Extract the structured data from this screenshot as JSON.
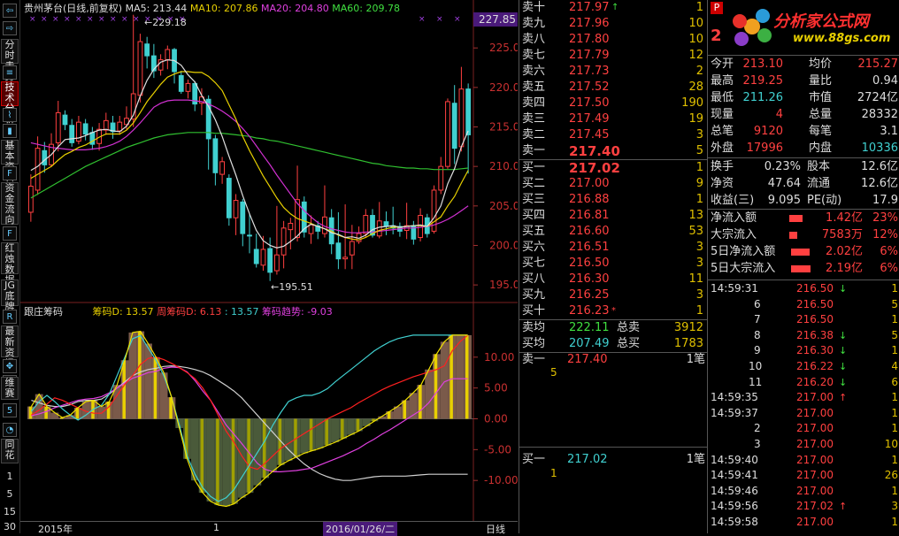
{
  "sidebar": {
    "items": [
      "分时走势",
      "技术分析",
      "基本资料",
      "资金流向",
      "红烛数据",
      "底牌",
      "JG",
      "最新资讯",
      "维赛",
      "同花",
      "资金",
      "点评",
      "诊测"
    ],
    "numbers": [
      "1",
      "5",
      "15",
      "30"
    ]
  },
  "chart": {
    "title": "贵州茅台(日线,前复权)",
    "ma5": "MA5: 213.44",
    "ma10": "MA10: 207.86",
    "ma20": "MA20: 204.80",
    "ma60": "MA60: 209.78",
    "price_tag": "227.85",
    "high_label": "229.18",
    "low_label": "195.51",
    "y_ticks": [
      "225.0",
      "220.0",
      "215.0",
      "210.0",
      "205.0",
      "200.0",
      "195.0"
    ],
    "sub_title": "跟庄筹码",
    "sub_d": "筹码D: 13.57",
    "sub_wd": "周筹码D: 6.13",
    "sub_val": ": 13.57",
    "sub_trend": "筹码趋势: -9.03",
    "sub_ticks": [
      "10.00",
      "5.00",
      "0.00",
      "-5.00",
      "-10.00"
    ],
    "x_left": "2015年",
    "x_mid": "1",
    "x_date": "2016/01/26/二",
    "x_right": "日线"
  },
  "chart_data": {
    "type": "candlestick",
    "title": "贵州茅台(日线,前复权)",
    "ylim": [
      193,
      229.5
    ],
    "candles": [
      [
        204.2,
        207.5,
        203.0,
        209.0
      ],
      [
        207.0,
        212.3,
        206.4,
        213.8
      ],
      [
        212.0,
        210.2,
        209.2,
        213.1
      ],
      [
        210.2,
        212.8,
        209.9,
        214.2
      ],
      [
        213.0,
        216.8,
        211.9,
        218.3
      ],
      [
        216.5,
        215.3,
        214.6,
        217.1
      ],
      [
        215.2,
        213.0,
        212.5,
        216.0
      ],
      [
        213.2,
        215.6,
        212.8,
        216.4
      ],
      [
        215.4,
        214.1,
        213.3,
        216.0
      ],
      [
        214.3,
        212.8,
        212.1,
        215.0
      ],
      [
        212.9,
        214.7,
        212.0,
        215.5
      ],
      [
        214.6,
        215.8,
        214.0,
        216.8
      ],
      [
        215.5,
        214.4,
        213.5,
        216.4
      ],
      [
        214.5,
        215.6,
        214.0,
        216.4
      ],
      [
        215.3,
        216.1,
        214.7,
        217.6
      ],
      [
        216.0,
        219.2,
        215.0,
        229.2
      ],
      [
        219.0,
        225.8,
        218.1,
        226.8
      ],
      [
        225.5,
        224.0,
        222.4,
        226.4
      ],
      [
        224.0,
        222.1,
        221.2,
        225.5
      ],
      [
        222.2,
        223.5,
        221.5,
        224.2
      ],
      [
        223.5,
        224.8,
        222.3,
        225.3
      ],
      [
        224.8,
        222.0,
        220.5,
        225.0
      ],
      [
        221.5,
        219.5,
        219.2,
        222.1
      ],
      [
        219.5,
        220.5,
        218.6,
        221.0
      ],
      [
        220.5,
        217.9,
        217.0,
        220.8
      ],
      [
        218.0,
        218.8,
        216.5,
        219.9
      ],
      [
        218.5,
        213.5,
        209.6,
        219.0
      ],
      [
        213.5,
        209.2,
        207.6,
        214.0
      ],
      [
        209.0,
        210.6,
        207.8,
        211.2
      ],
      [
        208.5,
        203.5,
        202.5,
        209.0
      ],
      [
        203.5,
        205.7,
        201.3,
        206.5
      ],
      [
        205.5,
        201.5,
        199.9,
        205.9
      ],
      [
        201.3,
        201.2,
        199.0,
        204.1
      ],
      [
        199.5,
        197.7,
        197.2,
        201.5
      ],
      [
        197.5,
        199.5,
        196.8,
        201.2
      ],
      [
        199.6,
        196.6,
        195.5,
        201.0
      ],
      [
        196.8,
        198.8,
        196.3,
        205.0
      ],
      [
        198.8,
        202.2,
        197.1,
        203.1
      ],
      [
        202.0,
        202.8,
        199.5,
        203.5
      ],
      [
        201.0,
        205.8,
        200.5,
        210.1
      ],
      [
        205.5,
        201.7,
        201.0,
        206.2
      ],
      [
        201.5,
        202.6,
        200.2,
        203.8
      ],
      [
        202.5,
        201.8,
        200.8,
        203.1
      ],
      [
        201.5,
        203.6,
        201.0,
        207.6
      ],
      [
        203.5,
        200.2,
        198.9,
        204.6
      ],
      [
        200.3,
        198.3,
        197.0,
        204.2
      ],
      [
        198.3,
        198.5,
        197.0,
        205.2
      ],
      [
        198.8,
        200.5,
        197.0,
        202.6
      ],
      [
        200.5,
        201.5,
        200.2,
        202.4
      ],
      [
        201.5,
        203.8,
        201.0,
        204.6
      ],
      [
        203.8,
        201.3,
        201.0,
        204.6
      ],
      [
        201.2,
        203.1,
        200.9,
        205.5
      ],
      [
        203.0,
        202.4,
        201.3,
        204.3
      ],
      [
        202.5,
        202.2,
        201.4,
        204.9
      ],
      [
        202.4,
        201.8,
        201.1,
        202.9
      ],
      [
        201.9,
        202.5,
        200.8,
        205.4
      ],
      [
        202.5,
        200.8,
        200.1,
        203.1
      ],
      [
        201.0,
        203.8,
        200.5,
        204.7
      ],
      [
        203.5,
        201.5,
        201.0,
        204.0
      ],
      [
        201.8,
        207.0,
        201.5,
        207.6
      ],
      [
        207.0,
        210.0,
        206.5,
        211.2
      ],
      [
        210.0,
        218.2,
        209.7,
        218.6
      ],
      [
        218.0,
        212.3,
        210.3,
        220.3
      ],
      [
        212.5,
        219.8,
        211.9,
        222.6
      ],
      [
        219.8,
        214.0,
        209.1,
        220.5
      ]
    ],
    "ma5": [
      209.5,
      210.0,
      210.8,
      211.5,
      212.5,
      213.4,
      213.5,
      213.6,
      213.9,
      214.3,
      214.6,
      214.7,
      214.5,
      214.4,
      215.1,
      216.5,
      218.9,
      220.9,
      222.3,
      223.2,
      223.5,
      223.4,
      222.8,
      221.6,
      220.7,
      219.0,
      217.6,
      215.9,
      213.8,
      211.3,
      208.9,
      206.3,
      204.0,
      201.9,
      200.6,
      200.0,
      199.7,
      199.9,
      200.5,
      201.2,
      202.1,
      202.7,
      202.4,
      202.1,
      201.6,
      201.4,
      201.0,
      201.1,
      200.9,
      201.3,
      202.0,
      202.3,
      202.4,
      202.5,
      202.3,
      202.4,
      202.5,
      202.6,
      202.4,
      203.5,
      205.0,
      207.8,
      209.7,
      212.5,
      214.5
    ],
    "ma10": [
      208.5,
      209.0,
      209.5,
      210.0,
      210.8,
      211.5,
      211.9,
      212.4,
      212.7,
      213.2,
      213.7,
      214.1,
      214.1,
      214.1,
      214.6,
      215.5,
      216.8,
      218.2,
      219.3,
      220.4,
      221.3,
      221.7,
      222.0,
      222.0,
      221.9,
      221.9,
      221.4,
      220.6,
      219.6,
      217.8,
      216.0,
      213.8,
      212.0,
      210.4,
      208.8,
      207.4,
      206.0,
      204.8,
      204.0,
      203.4,
      203.1,
      202.8,
      202.4,
      202.1,
      201.8,
      201.3,
      201.0,
      200.8,
      200.7,
      201.0,
      201.5,
      201.9,
      202.1,
      202.3,
      202.3,
      202.4,
      202.5,
      202.5,
      202.4,
      203.0,
      203.6,
      205.0,
      206.2,
      207.9,
      209.5
    ],
    "ma20": [
      213.0,
      212.8,
      212.6,
      212.4,
      212.3,
      212.2,
      212.1,
      212.1,
      212.1,
      212.2,
      212.3,
      212.5,
      212.8,
      213.2,
      213.8,
      214.6,
      215.5,
      216.5,
      217.5,
      218.0,
      218.3,
      218.4,
      218.4,
      218.4,
      218.3,
      218.2,
      217.9,
      217.5,
      217.0,
      216.4,
      215.7,
      214.8,
      213.8,
      212.6,
      211.4,
      210.2,
      208.9,
      207.7,
      206.5,
      205.3,
      204.4,
      203.6,
      202.9,
      202.4,
      202.1,
      201.9,
      201.7,
      201.6,
      201.6,
      201.7,
      201.7,
      201.8,
      201.9,
      202.0,
      202.1,
      202.2,
      202.2,
      202.3,
      202.4,
      202.6,
      202.9,
      203.3,
      203.8,
      204.4,
      205.0
    ],
    "ma60": [
      206.0,
      206.5,
      207.0,
      207.5,
      208.0,
      208.5,
      209.0,
      209.5,
      210.0,
      210.4,
      210.8,
      211.2,
      211.6,
      212.0,
      212.4,
      212.7,
      213.0,
      213.3,
      213.6,
      213.8,
      214.0,
      214.1,
      214.2,
      214.3,
      214.3,
      214.3,
      214.3,
      214.2,
      214.2,
      214.1,
      214.0,
      213.9,
      213.8,
      213.6,
      213.5,
      213.3,
      213.2,
      213.0,
      212.8,
      212.6,
      212.4,
      212.2,
      212.0,
      211.8,
      211.6,
      211.4,
      211.2,
      211.0,
      210.8,
      210.6,
      210.4,
      210.3,
      210.1,
      210.0,
      209.9,
      209.8,
      209.8,
      209.7,
      209.7,
      209.6,
      209.6,
      209.6,
      209.6,
      209.7,
      209.8
    ],
    "sub_series": {
      "white": [
        3.0,
        2.6,
        2.2,
        2.0,
        2.0,
        2.3,
        2.8,
        3.0,
        3.0,
        3.2,
        4.0,
        5.0,
        6.0,
        7.0,
        7.6,
        8.0,
        8.2,
        8.5,
        8.6,
        8.5,
        8.3,
        8.0,
        7.6,
        7.0,
        6.2,
        5.4,
        4.5,
        3.4,
        2.0,
        0.6,
        -0.8,
        -2.2,
        -3.6,
        -5.0,
        -6.2,
        -7.3,
        -8.2,
        -8.9,
        -9.4,
        -9.8,
        -10.0,
        -10.0,
        -9.8,
        -9.6,
        -9.4,
        -9.3,
        -9.3,
        -9.3,
        -9.3,
        -9.2,
        -9.1,
        -9.0,
        -9.0,
        -9.0,
        -9.0,
        -9.0,
        -9.0
      ],
      "magenta": [
        0.5,
        0.8,
        1.2,
        1.8,
        2.2,
        2.6,
        3.0,
        3.2,
        3.3,
        3.6,
        4.2,
        5.0,
        5.8,
        6.6,
        7.0,
        7.5,
        7.7,
        8.2,
        8.4,
        8.3,
        7.6,
        6.2,
        4.5,
        3.0,
        1.0,
        -1.0,
        -2.5,
        -4.0,
        -5.6,
        -7.2,
        -8.2,
        -8.6,
        -8.6,
        -8.5,
        -8.4,
        -8.2,
        -8.0,
        -7.5,
        -7.0,
        -6.5,
        -6.0,
        -5.4,
        -4.8,
        -4.0,
        -3.3,
        -2.5,
        -1.8,
        -1.0,
        -0.2,
        0.6,
        1.4,
        2.6,
        4.3,
        6.0,
        6.5,
        6.5,
        6.5
      ],
      "red": [
        0.6,
        1.4,
        2.4,
        3.4,
        3.0,
        2.4,
        1.8,
        1.2,
        0.9,
        0.9,
        2.0,
        3.8,
        5.6,
        7.0,
        8.8,
        9.8,
        10.0,
        9.6,
        9.0,
        8.3,
        7.5,
        6.5,
        5.0,
        3.0,
        0.5,
        -2.0,
        -3.8,
        -6.0,
        -7.8,
        -8.2,
        -7.2,
        -6.0,
        -4.8,
        -4.0,
        -3.2,
        -2.4,
        -1.6,
        -0.8,
        0.0,
        0.6,
        1.2,
        1.8,
        2.6,
        3.3,
        4.0,
        4.7,
        5.3,
        5.8,
        6.3,
        6.8,
        7.2,
        7.6,
        8.0,
        8.6,
        11.0,
        12.5,
        13.57
      ],
      "cyan": [
        1.2,
        2.8,
        3.8,
        2.8,
        1.6,
        0.6,
        -0.2,
        0.6,
        1.6,
        2.2,
        4.0,
        7.0,
        10.0,
        13.0,
        13.5,
        11.5,
        9.5,
        7.0,
        3.5,
        -1.0,
        -6.0,
        -9.0,
        -11.2,
        -12.6,
        -13.4,
        -12.8,
        -11.5,
        -9.5,
        -7.5,
        -5.5,
        -3.5,
        -1.0,
        1.0,
        2.8,
        3.4,
        3.8,
        3.8,
        4.2,
        4.9,
        6.0,
        7.0,
        8.0,
        9.0,
        10.0,
        11.0,
        11.8,
        12.5,
        13.0,
        13.3,
        13.57,
        13.57,
        13.57,
        13.57,
        13.57,
        13.57,
        13.57,
        13.57
      ],
      "yellow": [
        2.0,
        4.0,
        2.0,
        1.0,
        0.2,
        0.6,
        1.8,
        2.8,
        3.0,
        2.0,
        2.8,
        5.5,
        9.5,
        14.0,
        14.2,
        12.2,
        10.0,
        7.5,
        3.5,
        -1.5,
        -6.5,
        -10.0,
        -12.0,
        -13.4,
        -14.0,
        -14.2,
        -13.8,
        -12.8,
        -12.0,
        -10.8,
        -9.6,
        -8.5,
        -7.5,
        -6.8,
        -6.2,
        -5.6,
        -5.2,
        -4.8,
        -4.3,
        -3.8,
        -3.2,
        -2.6,
        -2.0,
        -1.2,
        -0.4,
        0.4,
        1.2,
        2.0,
        3.0,
        4.2,
        5.5,
        8.0,
        10.5,
        12.5,
        13.57,
        13.57,
        13.57
      ]
    }
  },
  "book": {
    "sells": [
      {
        "label": "卖十",
        "price": "217.97",
        "vol": "1",
        "arrow": "↑"
      },
      {
        "label": "卖九",
        "price": "217.96",
        "vol": "10",
        "arrow": ""
      },
      {
        "label": "卖八",
        "price": "217.80",
        "vol": "10",
        "arrow": ""
      },
      {
        "label": "卖七",
        "price": "217.79",
        "vol": "12",
        "arrow": ""
      },
      {
        "label": "卖六",
        "price": "217.73",
        "vol": "2",
        "arrow": ""
      },
      {
        "label": "卖五",
        "price": "217.52",
        "vol": "28",
        "arrow": ""
      },
      {
        "label": "卖四",
        "price": "217.50",
        "vol": "190",
        "arrow": ""
      },
      {
        "label": "卖三",
        "price": "217.49",
        "vol": "19",
        "arrow": ""
      },
      {
        "label": "卖二",
        "price": "217.45",
        "vol": "3",
        "arrow": ""
      },
      {
        "label": "卖一",
        "price": "217.40",
        "vol": "5",
        "arrow": ""
      }
    ],
    "buys": [
      {
        "label": "买一",
        "price": "217.02",
        "vol": "1",
        "arrow": ""
      },
      {
        "label": "买二",
        "price": "217.00",
        "vol": "9",
        "arrow": ""
      },
      {
        "label": "买三",
        "price": "216.88",
        "vol": "1",
        "arrow": ""
      },
      {
        "label": "买四",
        "price": "216.81",
        "vol": "13",
        "arrow": ""
      },
      {
        "label": "买五",
        "price": "216.60",
        "vol": "53",
        "arrow": ""
      },
      {
        "label": "买六",
        "price": "216.51",
        "vol": "3",
        "arrow": ""
      },
      {
        "label": "买七",
        "price": "216.50",
        "vol": "3",
        "arrow": ""
      },
      {
        "label": "买八",
        "price": "216.30",
        "vol": "11",
        "arrow": ""
      },
      {
        "label": "买九",
        "price": "216.25",
        "vol": "3",
        "arrow": ""
      },
      {
        "label": "买十",
        "price": "216.23",
        "vol": "1",
        "arrow": "*"
      }
    ],
    "avg_sell_label": "卖均",
    "avg_sell": "222.11",
    "total_sell_label": "总卖",
    "total_sell": "3912",
    "avg_buy_label": "买均",
    "avg_buy": "207.49",
    "total_buy_label": "总买",
    "total_buy": "1783",
    "q_sell_label": "卖一",
    "q_sell_price": "217.40",
    "q_sell_count": "1笔",
    "q_sell_item": "5",
    "q_buy_label": "买一",
    "q_buy_price": "217.02",
    "q_buy_count": "1笔",
    "q_buy_item": "1"
  },
  "info": {
    "badge": "P",
    "big": "2",
    "logo_cn": "分析家公式网",
    "logo_url": "www.88gs.com",
    "rows": [
      {
        "l1": "今开",
        "v1": "213.10",
        "l2": "均价",
        "v2": "215.27"
      },
      {
        "l1": "最高",
        "v1": "219.25",
        "l2": "量比",
        "v2": "0.94"
      },
      {
        "l1": "最低",
        "v1": "211.26",
        "l2": "市值",
        "v2": "2724亿"
      },
      {
        "l1": "现量",
        "v1": "4",
        "l2": "总量",
        "v2": "28332"
      },
      {
        "l1": "总笔",
        "v1": "9120",
        "l2": "每笔",
        "v2": "3.1"
      },
      {
        "l1": "外盘",
        "v1": "17996",
        "l2": "内盘",
        "v2": "10336"
      }
    ],
    "rows2": [
      {
        "l1": "换手",
        "v1": "0.23%",
        "l2": "股本",
        "v2": "12.6亿"
      },
      {
        "l1": "净资",
        "v1": "47.64",
        "l2": "流通",
        "v2": "12.6亿"
      },
      {
        "l1": "收益(三)",
        "v1": "9.095",
        "l2": "PE(动)",
        "v2": "17.9"
      }
    ],
    "flows": [
      {
        "label": "净流入额",
        "val": "1.42亿",
        "pct": "23%"
      },
      {
        "label": "大宗流入",
        "val": "7583万",
        "pct": "12%"
      },
      {
        "label": "5日净流入额",
        "val": "2.02亿",
        "pct": "6%"
      },
      {
        "label": "5日大宗流入",
        "val": "2.19亿",
        "pct": "6%"
      }
    ],
    "flow_bar_fill": [
      0.62,
      0.36,
      0.86,
      0.93
    ],
    "ticks": [
      {
        "t": "14:59:31",
        "p": "216.50",
        "a": "↓",
        "v": "1"
      },
      {
        "t": "6",
        "p": "216.50",
        "a": "",
        "v": "5"
      },
      {
        "t": "7",
        "p": "216.50",
        "a": "",
        "v": "1"
      },
      {
        "t": "8",
        "p": "216.38",
        "a": "↓",
        "v": "5"
      },
      {
        "t": "9",
        "p": "216.30",
        "a": "↓",
        "v": "1"
      },
      {
        "t": "10",
        "p": "216.22",
        "a": "↓",
        "v": "4"
      },
      {
        "t": "11",
        "p": "216.20",
        "a": "↓",
        "v": "6"
      },
      {
        "t": "14:59:35",
        "p": "217.00",
        "a": "↑",
        "v": "1"
      },
      {
        "t": "14:59:37",
        "p": "217.00",
        "a": "",
        "v": "1"
      },
      {
        "t": "2",
        "p": "217.00",
        "a": "",
        "v": "1"
      },
      {
        "t": "3",
        "p": "217.00",
        "a": "",
        "v": "10"
      },
      {
        "t": "14:59:40",
        "p": "217.00",
        "a": "",
        "v": "1"
      },
      {
        "t": "14:59:41",
        "p": "217.00",
        "a": "",
        "v": "26"
      },
      {
        "t": "14:59:46",
        "p": "217.00",
        "a": "",
        "v": "1"
      },
      {
        "t": "14:59:56",
        "p": "217.02",
        "a": "↑",
        "v": "3"
      },
      {
        "t": "14:59:58",
        "p": "217.00",
        "a": "",
        "v": "1"
      }
    ]
  }
}
